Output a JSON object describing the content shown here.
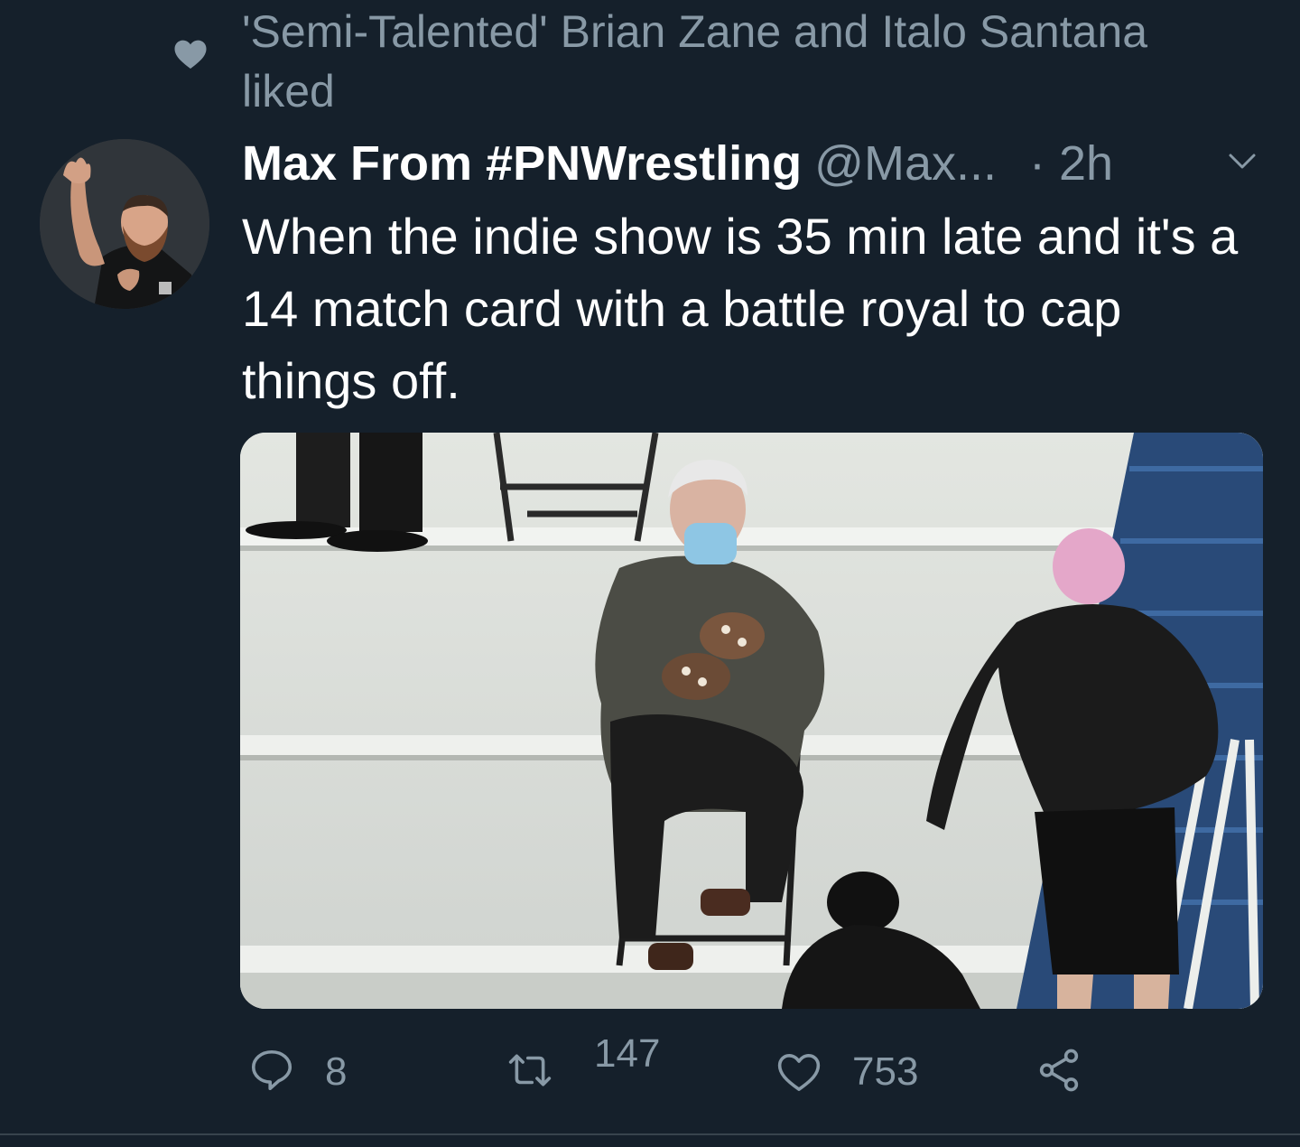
{
  "social_context": {
    "text": "'Semi-Talented' Brian Zane and Italo Santana liked",
    "icon": "heart-icon"
  },
  "tweet": {
    "author_name": "Max From #PNWrestling",
    "author_handle": "@Max...",
    "time": "· 2h",
    "text": "When the indie show is 35 min late and it's a 14 match card with a battle royal to cap things off.",
    "media_icon": "photo"
  },
  "actions": {
    "reply": {
      "icon": "reply-icon",
      "count": "8"
    },
    "retweet": {
      "icon": "retweet-icon",
      "count": "147"
    },
    "like": {
      "icon": "like-icon",
      "count": "753"
    },
    "share": {
      "icon": "share-icon"
    }
  },
  "colors": {
    "background": "#15202b",
    "secondary_text": "#8899a6",
    "primary_text": "#ffffff"
  }
}
